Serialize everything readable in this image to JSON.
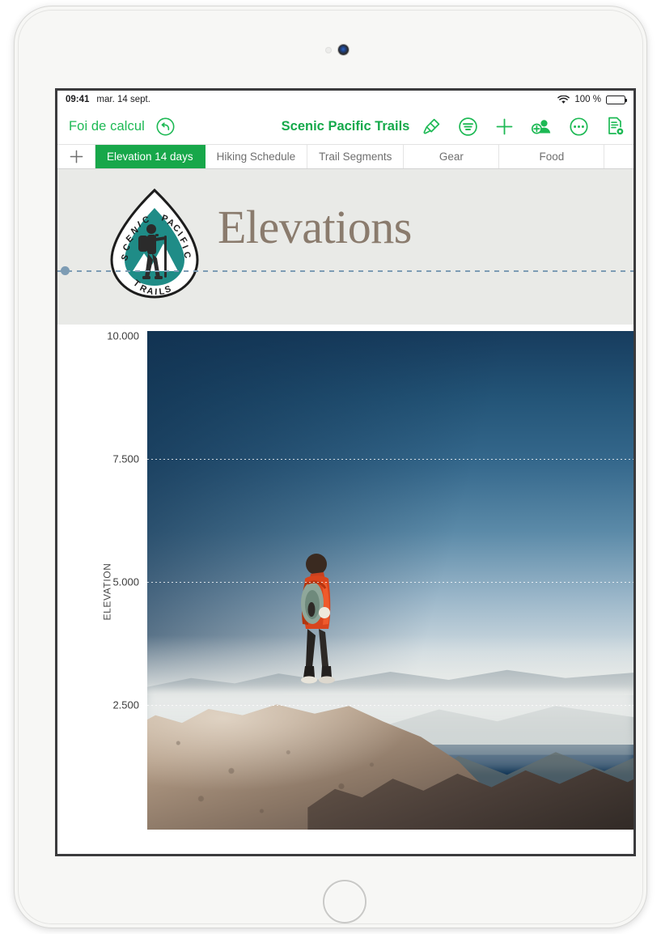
{
  "status_bar": {
    "time": "09:41",
    "date": "mar. 14 sept.",
    "wifi_icon": "wifi-icon",
    "battery_percent": "100 %",
    "battery_icon": "battery-full-icon"
  },
  "toolbar": {
    "back_label": "Foi de calcul",
    "undo_icon": "undo-icon",
    "document_title": "Scenic Pacific Trails",
    "icons": [
      {
        "name": "format-paintbrush-icon",
        "label": "Format"
      },
      {
        "name": "insert-organize-icon",
        "label": "Organiser"
      },
      {
        "name": "add-icon",
        "label": "Insérer"
      },
      {
        "name": "add-collaborator-icon",
        "label": "Collaborer"
      },
      {
        "name": "more-options-icon",
        "label": "Plus"
      },
      {
        "name": "document-preview-icon",
        "label": "Aperçu"
      }
    ]
  },
  "tab_bar": {
    "add_tab_icon": "add-sheet-icon",
    "tabs": [
      {
        "label": "Elevation 14 days",
        "active": true
      },
      {
        "label": "Hiking Schedule",
        "active": false
      },
      {
        "label": "Trail Segments",
        "active": false
      },
      {
        "label": "Gear",
        "active": false
      },
      {
        "label": "Food",
        "active": false
      }
    ]
  },
  "sheet": {
    "heading": "Elevations",
    "logo": {
      "top_arc_left": "SCENIC",
      "top_arc_right": "PACIFIC",
      "bottom_text": "TRAILS",
      "badge_color": "#1F8C87",
      "hiker_color": "#2b2b2b"
    },
    "alignment_guide_color": "#7d9cb4"
  },
  "colors": {
    "accent_green": "#1DB954",
    "active_tab_green": "#17A74A",
    "title_green": "#15a94b",
    "heading_brown": "#8a7b6d",
    "header_band": "#e9eae7"
  },
  "chart_data": {
    "type": "line",
    "title": "Elevations",
    "xlabel": "",
    "ylabel": "ELEVATION",
    "ylim": [
      0,
      10000
    ],
    "y_ticks": [
      "10.000",
      "7.500",
      "5.000",
      "2.500"
    ],
    "y_tick_values": [
      10000,
      7500,
      5000,
      2500
    ],
    "grid": true,
    "gridline_count": 3,
    "legend": "none",
    "fill_image": "hiker-on-mountain-summit-photo",
    "notes": "Chart plot area is filled with a photograph of a hiker overlooking a misty mountain valley; dotted horizontal gridlines at 7.500, 5.000 and 2.500."
  }
}
